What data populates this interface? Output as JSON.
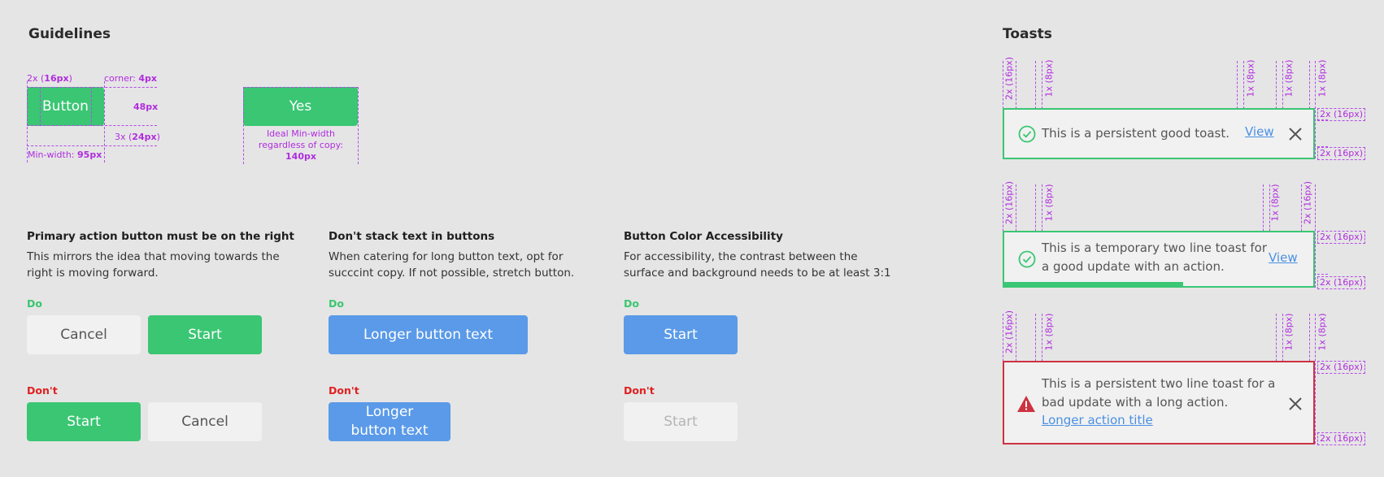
{
  "guidelines": {
    "title": "Guidelines",
    "spec": {
      "button_label": "Button",
      "padding_2x_prefix": "2x (",
      "padding_2x_value": "16px",
      "padding_2x_suffix": ")",
      "corner_prefix": "corner: ",
      "corner_value": "4px",
      "height_value": "48px",
      "padding_3x_prefix": "3x (",
      "padding_3x_value": "24px",
      "padding_3x_suffix": ")",
      "minwidth_prefix": "Min-width: ",
      "minwidth_value": "95px",
      "yes_label": "Yes",
      "ideal_line1": "Ideal Min-width",
      "ideal_line2": "regardless of copy:",
      "ideal_value": "140px"
    },
    "sections": [
      {
        "heading": "Primary action button must be on the right",
        "desc_line1": "This mirrors the idea that moving towards the",
        "desc_line2": "right is moving forward.",
        "do_label": "Do",
        "do_buttons": [
          "Cancel",
          "Start"
        ],
        "dont_label": "Don't",
        "dont_buttons": [
          "Start",
          "Cancel"
        ]
      },
      {
        "heading": "Don't stack text in buttons",
        "desc_line1": "When catering for long button text, opt for",
        "desc_line2": "succcint copy. If not possible, stretch button.",
        "do_label": "Do",
        "do_button": "Longer button text",
        "dont_label": "Don't",
        "dont_button_line1": "Longer",
        "dont_button_line2": "button text"
      },
      {
        "heading": "Button Color Accessibility",
        "desc_line1": "For accessibility, the contrast between the",
        "desc_line2": "surface and background needs to be at least 3:1",
        "do_label": "Do",
        "do_button": "Start",
        "dont_label": "Don't",
        "dont_button": "Start"
      }
    ]
  },
  "toasts": {
    "title": "Toasts",
    "spacing_2x": "2x (16px)",
    "spacing_1x": "1x (8px)",
    "items": [
      {
        "type": "good",
        "icon": "check-circle-icon",
        "text": "This is a persistent good toast.",
        "action": "View",
        "closable": true
      },
      {
        "type": "good",
        "icon": "check-circle-icon",
        "text_line1": "This is a temporary two line toast for",
        "text_line2": "a good update with an action.",
        "action": "View",
        "closable": false,
        "progress": 0.58
      },
      {
        "type": "bad",
        "icon": "warning-triangle-icon",
        "text_line1": "This is a persistent two line toast for a",
        "text_line2": "bad update with a long action.",
        "action": "Longer action title",
        "closable": true
      }
    ]
  },
  "colors": {
    "green": "#3ac673",
    "blue": "#5a9ae8",
    "red": "#cc3340",
    "spec_purple": "#b02cdf",
    "link": "#4a90e2"
  }
}
